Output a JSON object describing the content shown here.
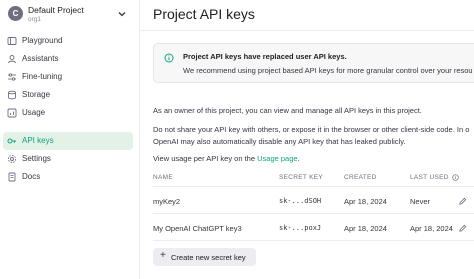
{
  "project": {
    "avatar_letter": "C",
    "name": "Default Project",
    "org": "org1"
  },
  "nav": [
    {
      "label": "Playground",
      "icon": "playground-icon"
    },
    {
      "label": "Assistants",
      "icon": "assistants-icon"
    },
    {
      "label": "Fine-tuning",
      "icon": "fine-tuning-icon"
    },
    {
      "label": "Storage",
      "icon": "storage-icon"
    },
    {
      "label": "Usage",
      "icon": "usage-icon"
    },
    {
      "label": "API keys",
      "icon": "key-icon",
      "active": true
    },
    {
      "label": "Settings",
      "icon": "gear-icon"
    },
    {
      "label": "Docs",
      "icon": "docs-icon"
    }
  ],
  "page": {
    "title": "Project API keys",
    "info_title": "Project API keys have replaced user API keys.",
    "info_text": "We recommend using project based API keys for more granular control over your resou",
    "para1": "As an owner of this project, you can view and manage all API keys in this project.",
    "para2a": "Do not share your API key with others, or expose it in the browser or other client-side code. In o",
    "para2b": "OpenAI may also automatically disable any API key that has leaked publicly.",
    "para3_prefix": "View usage per API key on the ",
    "para3_link": "Usage page",
    "para3_suffix": "."
  },
  "table": {
    "headers": {
      "name": "NAME",
      "secret": "SECRET KEY",
      "created": "CREATED",
      "last_used": "LAST USED"
    },
    "rows": [
      {
        "name": "myKey2",
        "secret": "sk-...dSOH",
        "created": "Apr 18, 2024",
        "last_used": "Never"
      },
      {
        "name": "My OpenAI ChatGPT key3",
        "secret": "sk-...poxJ",
        "created": "Apr 18, 2024",
        "last_used": "Apr 18, 2024"
      }
    ]
  },
  "create_button": {
    "label": "Create new secret key"
  },
  "colors": {
    "accent": "#10a37f",
    "active_bg": "#e3f1e6"
  }
}
